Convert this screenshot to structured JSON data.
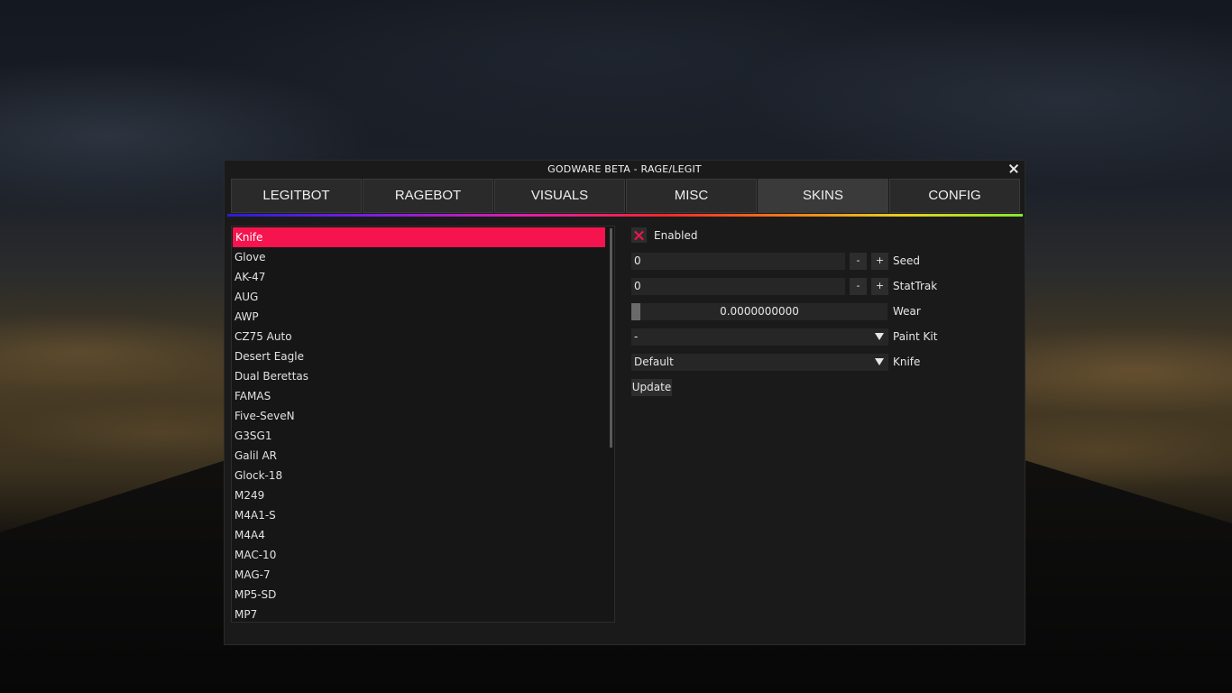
{
  "window": {
    "title": "GODWARE BETA - RAGE/LEGIT"
  },
  "tabs": [
    {
      "label": "LEGITBOT"
    },
    {
      "label": "RAGEBOT"
    },
    {
      "label": "VISUALS"
    },
    {
      "label": "MISC"
    },
    {
      "label": "SKINS",
      "active": true
    },
    {
      "label": "CONFIG"
    }
  ],
  "weapons": {
    "selected": "Knife",
    "items": [
      "Knife",
      "Glove",
      "AK-47",
      "AUG",
      "AWP",
      "CZ75 Auto",
      "Desert Eagle",
      "Dual Berettas",
      "FAMAS",
      "Five-SeveN",
      "G3SG1",
      "Galil AR",
      "Glock-18",
      "M249",
      "M4A1-S",
      "M4A4",
      "MAC-10",
      "MAG-7",
      "MP5-SD",
      "MP7"
    ]
  },
  "settings": {
    "enabled": {
      "label": "Enabled",
      "checked": true
    },
    "seed": {
      "value": "0",
      "label": "Seed",
      "minus": "-",
      "plus": "+"
    },
    "stattrak": {
      "value": "0",
      "label": "StatTrak",
      "minus": "-",
      "plus": "+"
    },
    "wear": {
      "value_text": "0.0000000000",
      "value": 0.0,
      "label": "Wear"
    },
    "paint_kit": {
      "value": "-",
      "label": "Paint Kit"
    },
    "knife": {
      "value": "Default",
      "label": "Knife"
    },
    "update_label": "Update"
  },
  "colors": {
    "accent": "#f5144d",
    "background": "#1a1a1a"
  }
}
